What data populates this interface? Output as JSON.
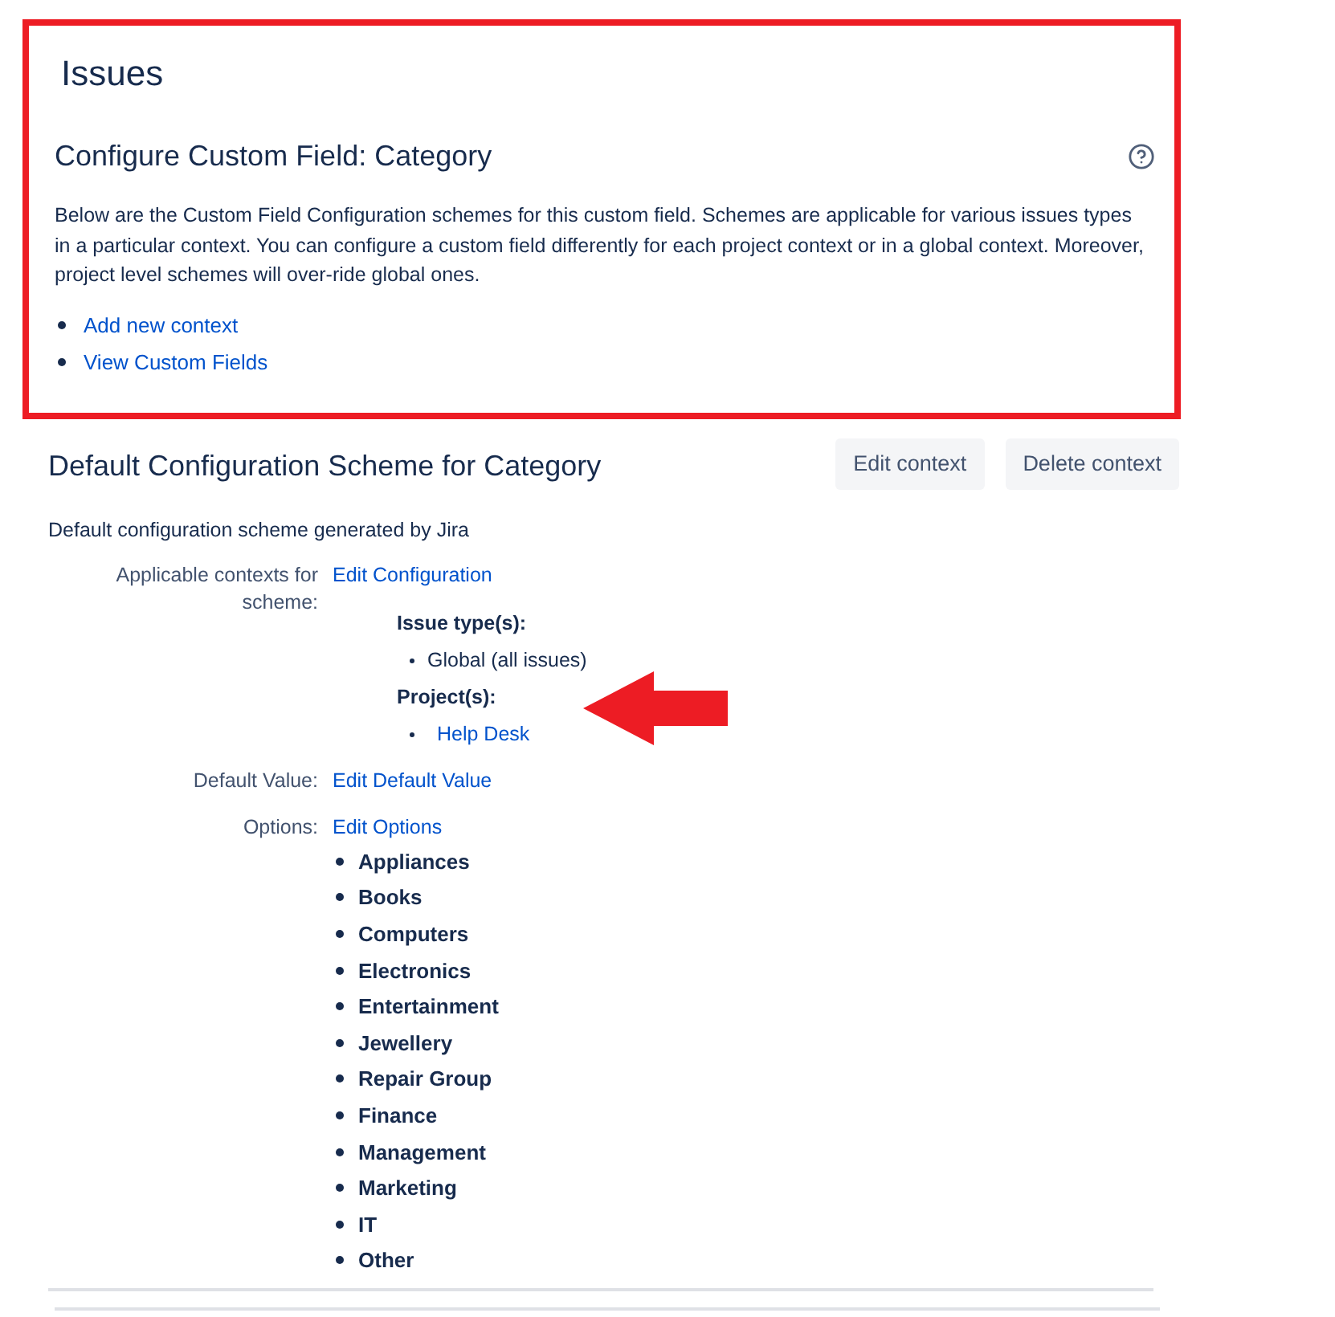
{
  "page_title": "Issues",
  "field_config": {
    "title": "Configure Custom Field: Category",
    "description": "Below are the Custom Field Configuration schemes for this custom field. Schemes are applicable for various issues types in a particular context. You can configure a custom field differently for each project context or in a global context. Moreover, project level schemes will over-ride global ones.",
    "links": [
      "Add new context",
      "View Custom Fields"
    ]
  },
  "scheme": {
    "title": "Default Configuration Scheme for Category",
    "buttons": [
      "Edit context",
      "Delete context"
    ],
    "description": "Default configuration scheme generated by Jira",
    "contexts": {
      "label": "Applicable contexts for scheme:",
      "link": "Edit Configuration",
      "issue_types_label": "Issue type(s):",
      "issue_types": [
        "Global (all issues)"
      ],
      "projects_label": "Project(s):",
      "projects": [
        "Help Desk"
      ]
    },
    "default_value": {
      "label": "Default Value:",
      "link": "Edit Default Value"
    },
    "options": {
      "label": "Options:",
      "link": "Edit Options",
      "items": [
        "Appliances",
        "Books",
        "Computers",
        "Electronics",
        "Entertainment",
        "Jewellery",
        "Repair Group",
        "Finance",
        "Management",
        "Marketing",
        "IT",
        "Other"
      ]
    }
  }
}
